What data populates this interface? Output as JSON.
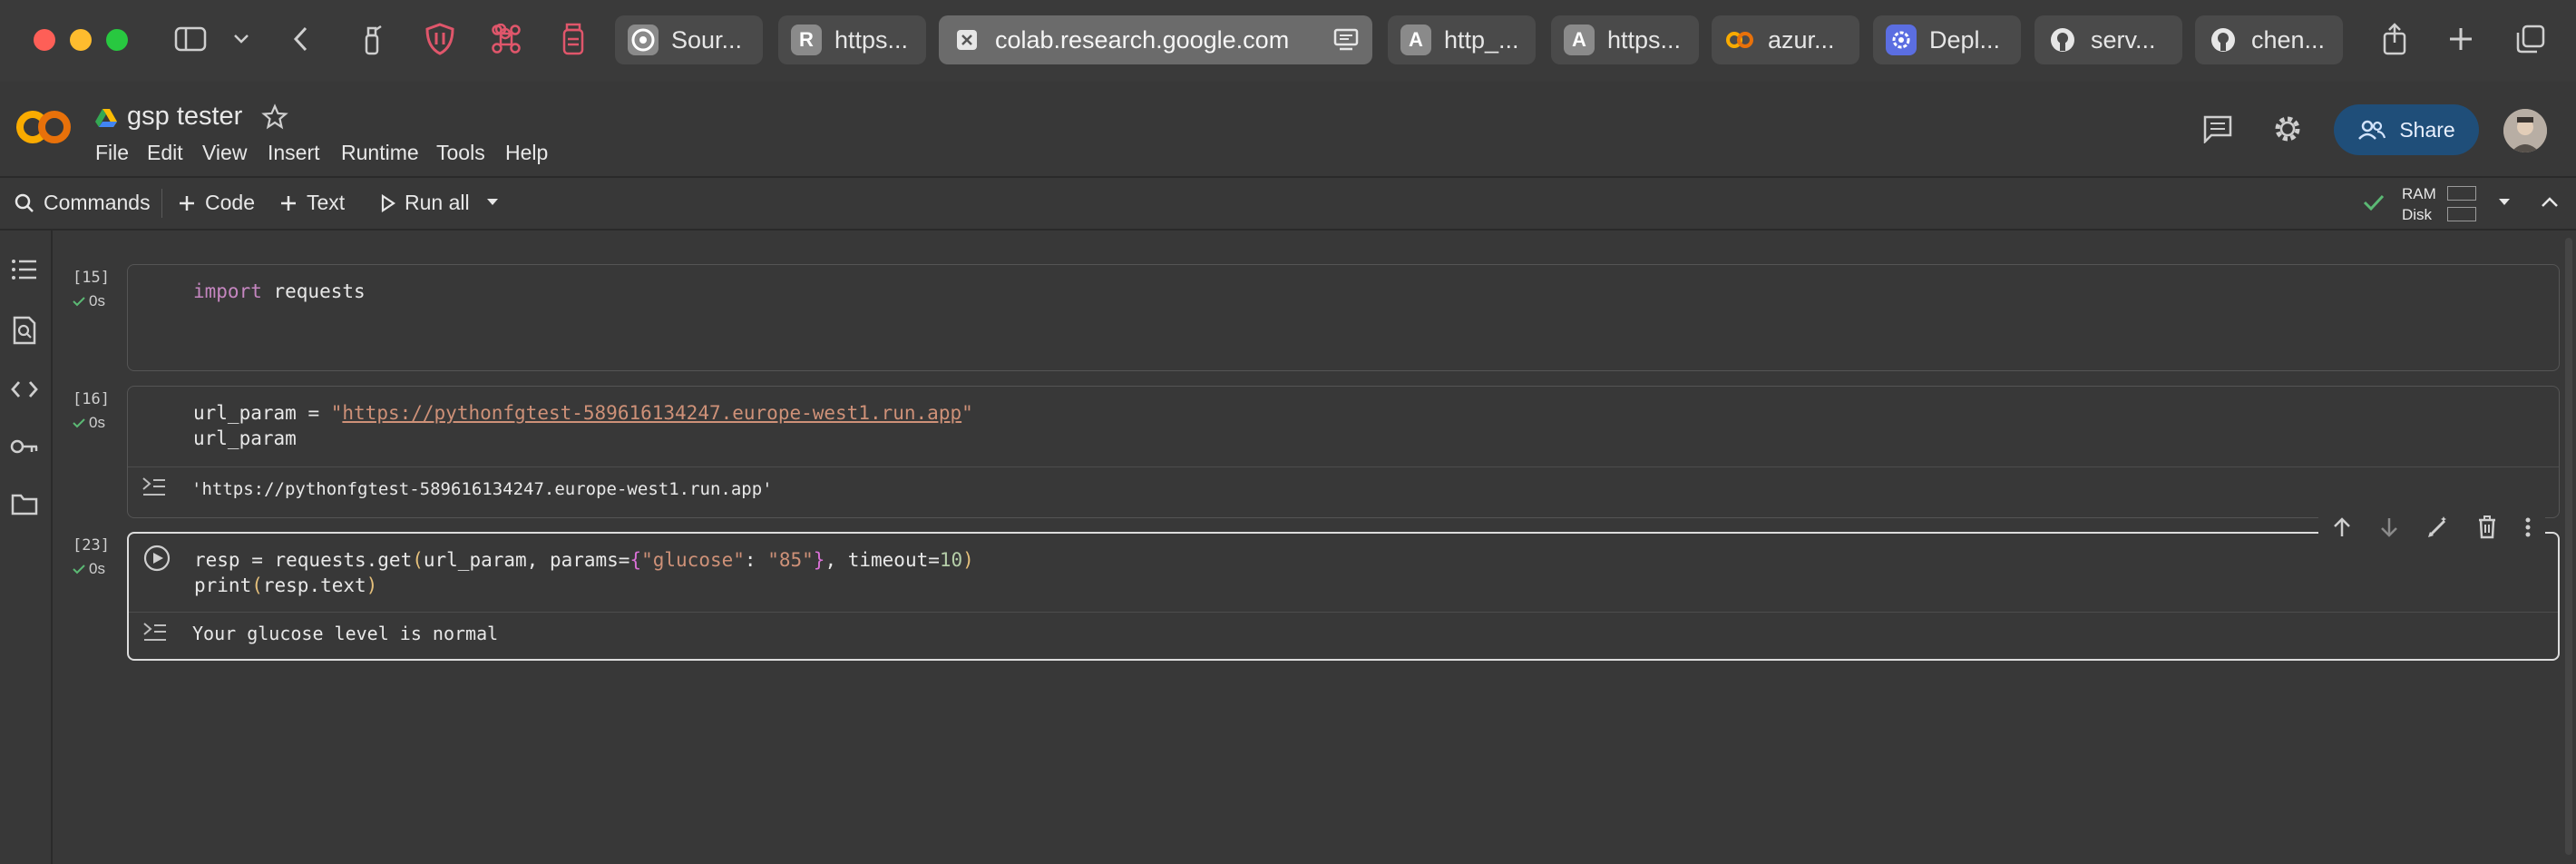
{
  "browser": {
    "tabs": [
      {
        "label": "Sour...",
        "favicon": "chrome-icon",
        "active": false
      },
      {
        "label": "https...",
        "favicon": "R",
        "active": false
      },
      {
        "label": "colab.research.google.com",
        "favicon": "close-icon",
        "active": true
      },
      {
        "label": "http_...",
        "favicon": "A",
        "active": false
      },
      {
        "label": "https...",
        "favicon": "A",
        "active": false
      },
      {
        "label": "azur...",
        "favicon": "colab-icon",
        "active": false
      },
      {
        "label": "Depl...",
        "favicon": "gear-icon",
        "active": false
      },
      {
        "label": "serv...",
        "favicon": "github-icon",
        "active": false
      },
      {
        "label": "chen...",
        "favicon": "github-icon",
        "active": false
      }
    ]
  },
  "notebook": {
    "title": "gsp tester",
    "logo_text": "CO",
    "menu": [
      "File",
      "Edit",
      "View",
      "Insert",
      "Runtime",
      "Tools",
      "Help"
    ],
    "share_label": "Share"
  },
  "toolbar": {
    "commands_label": "Commands",
    "code_label": "Code",
    "text_label": "Text",
    "run_all_label": "Run all",
    "ram_label": "RAM",
    "disk_label": "Disk"
  },
  "cells": [
    {
      "count": "[15]",
      "time": "0s",
      "code_lines": [
        "import requests"
      ]
    },
    {
      "count": "[16]",
      "time": "0s",
      "code_var": "url_param",
      "code_url": "https://pythonfgtest-589616134247.europe-west1.run.app",
      "code_line2": "url_param",
      "output": "'https://pythonfgtest-589616134247.europe-west1.run.app'"
    },
    {
      "count": "[23]",
      "time": "0s",
      "code_line1_a": "resp = requests.get",
      "code_line1_b": "url_param, params=",
      "code_line1_key": "\"glucose\"",
      "code_line1_val": "\"85\"",
      "code_line1_c": ", timeout=",
      "code_line1_num": "10",
      "code_line2_fn": "print",
      "code_line2_arg": "resp.text",
      "output": "Your glucose level is normal"
    }
  ],
  "colors": {
    "accent_blue": "#1f4e79",
    "colab_orange": "#f9ab00",
    "check_green": "#5bb974"
  }
}
